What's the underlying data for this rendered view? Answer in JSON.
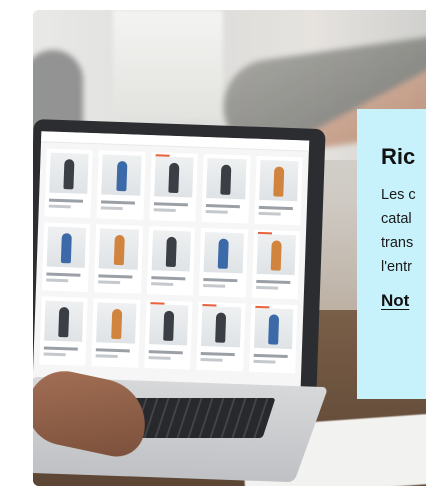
{
  "panel": {
    "title": "Ric",
    "lines": [
      "Les c",
      "catal",
      "trans",
      "l'entr"
    ],
    "link": "Not"
  },
  "colors": {
    "panel_bg": "#c7f1fb",
    "accent_tag": "#e8623c"
  }
}
